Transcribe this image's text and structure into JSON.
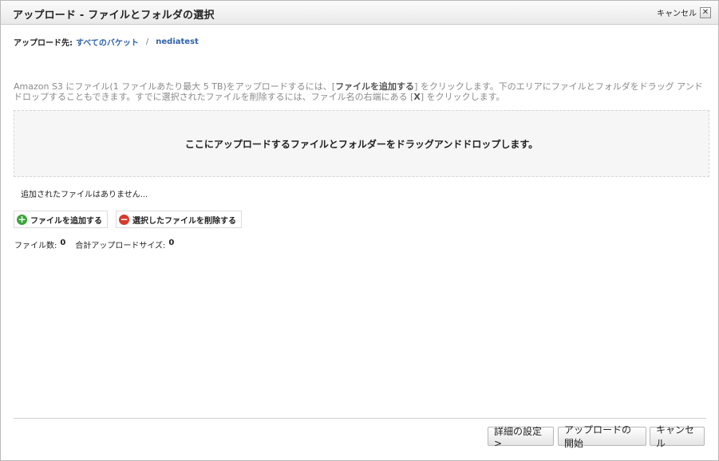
{
  "window": {
    "title": "アップロード - ファイルとフォルダの選択",
    "cancel_label": "キャンセル",
    "close_glyph": "✕"
  },
  "breadcrumb": {
    "label": "アップロード先:",
    "items": [
      "すべてのバケット",
      "nediatest"
    ],
    "separator": "/"
  },
  "instructions": {
    "part1": "Amazon S3 にファイル(1 ファイルあたり最大 5 TB)をアップロードするには、[",
    "add_link": "ファイルを追加する",
    "part2": "] をクリックします。下のエリアにファイルとフォルダをドラッグ アンドドロップすることもできます。すでに選択されたファイルを削除するには、ファイル名の右端にある [",
    "x_label": "X",
    "part3": "] をクリックします。"
  },
  "dropzone": {
    "text": "ここにアップロードするファイルとフォルダーをドラッグアンドドロップします。"
  },
  "file_list": {
    "empty_text": "追加されたファイルはありません..."
  },
  "actions": {
    "add_label": "ファイルを追加する",
    "remove_label": "選択したファイルを削除する",
    "add_icon": "+",
    "remove_icon": "−"
  },
  "summary": {
    "files_label": "ファイル数:",
    "files_value": "0",
    "size_label": "合計アップロードサイズ:",
    "size_value": "0"
  },
  "footer": {
    "advanced_label": "詳細の設定 >",
    "start_label": "アップロードの開始",
    "cancel_label": "キャンセル"
  },
  "icons": {
    "close": "close-icon",
    "add": "plus-circle-icon",
    "remove": "minus-circle-icon"
  },
  "colors": {
    "link": "#3062a8",
    "add_icon": "#3aa53a",
    "remove_icon": "#d63a2f"
  }
}
